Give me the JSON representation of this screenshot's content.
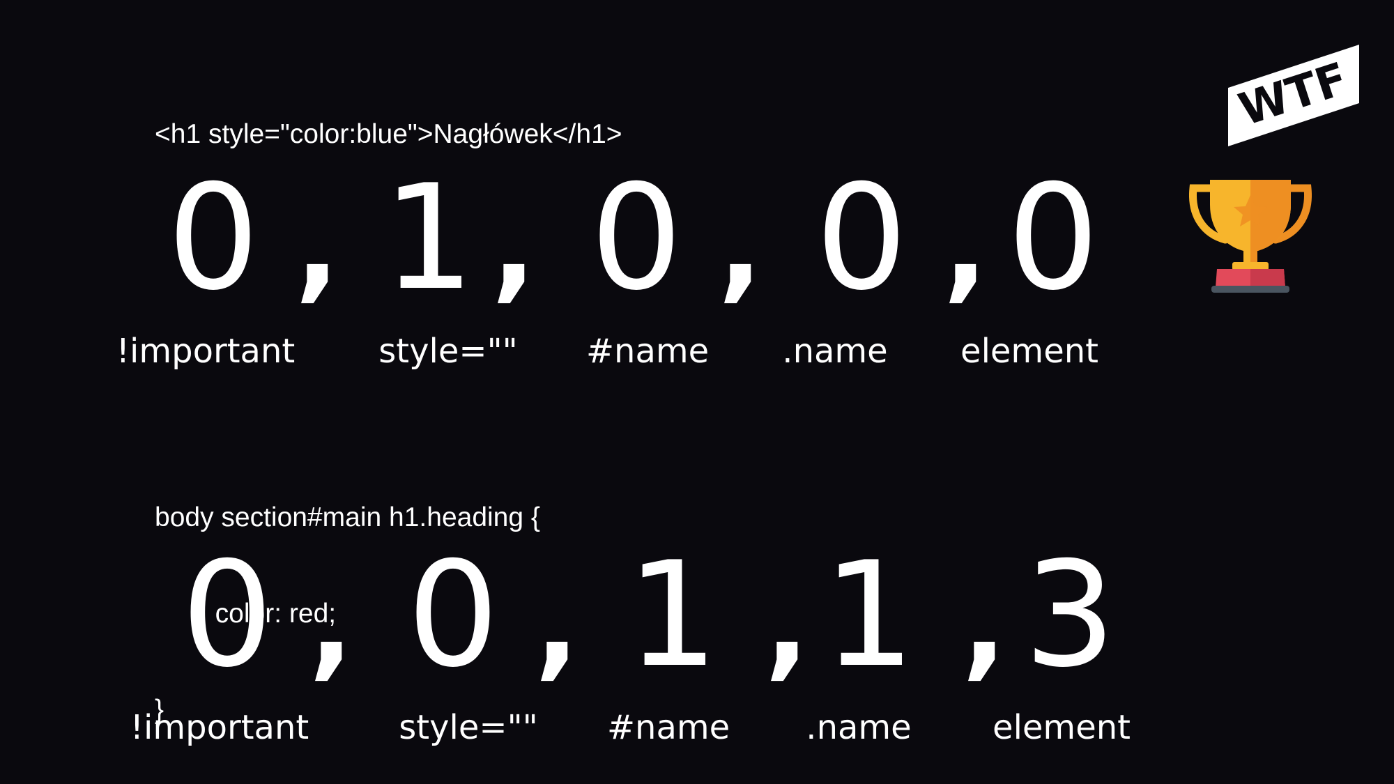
{
  "example1": {
    "code": "<h1 style=\"color:blue\">Nagłówek</h1>",
    "values": [
      "0",
      "1",
      "0",
      "0",
      "0"
    ],
    "separator": ",",
    "labels": [
      "!important",
      "style=\"\"",
      "#name",
      ".name",
      "element"
    ]
  },
  "example2": {
    "code_lines": [
      "body section#main h1.heading {",
      "        color: red;",
      "}"
    ],
    "values": [
      "0",
      "0",
      "1",
      "1",
      "3"
    ],
    "separator": ",",
    "labels": [
      "!important",
      "style=\"\"",
      "#name",
      ".name",
      "element"
    ]
  },
  "logo": {
    "text": "WTF",
    "icon": "wtf-logo-icon"
  },
  "winner": {
    "icon": "trophy-icon"
  },
  "colors": {
    "background": "#0a090e",
    "text": "#ffffff",
    "trophy_gold": "#f7b52c",
    "trophy_orange": "#ee8f22",
    "trophy_base": "#e24a5a",
    "trophy_plate": "#4a5560"
  }
}
